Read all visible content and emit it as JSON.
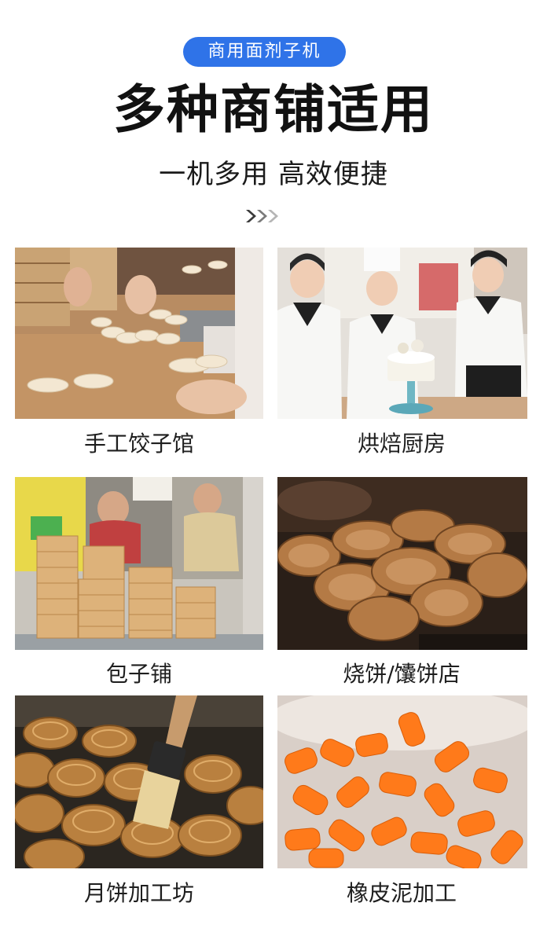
{
  "header": {
    "badge_label": "商用面剂子机",
    "title": "多种商铺适用",
    "subtitle": "一机多用 高效便捷",
    "arrow_icon": "chevrons-right-icon"
  },
  "scenarios": [
    {
      "caption": "手工饺子馆"
    },
    {
      "caption": "烘焙厨房"
    },
    {
      "caption": "包子铺"
    },
    {
      "caption": "烧饼/馕饼店"
    },
    {
      "caption": "月饼加工坊"
    },
    {
      "caption": "橡皮泥加工"
    }
  ]
}
